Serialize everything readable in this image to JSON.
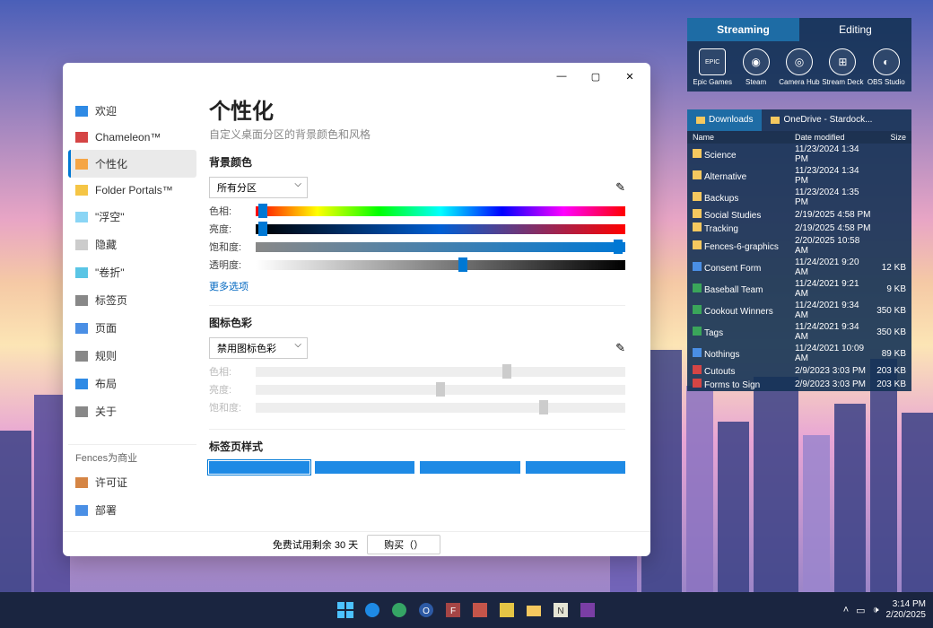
{
  "appWidget": {
    "tabs": [
      "Streaming",
      "Editing"
    ],
    "apps": [
      {
        "label": "Epic Games",
        "icon": "EPIC"
      },
      {
        "label": "Steam",
        "icon": "◉"
      },
      {
        "label": "Camera Hub",
        "icon": "◎"
      },
      {
        "label": "Stream Deck",
        "icon": "⊞"
      },
      {
        "label": "OBS Studio",
        "icon": "◐"
      }
    ]
  },
  "filesWidget": {
    "tabs": [
      "Downloads",
      "OneDrive - Stardock..."
    ],
    "headers": {
      "name": "Name",
      "date": "Date modified",
      "size": "Size"
    },
    "rows": [
      {
        "name": "Science",
        "date": "11/23/2024 1:34 PM",
        "size": "",
        "type": "folder"
      },
      {
        "name": "Alternative",
        "date": "11/23/2024 1:34 PM",
        "size": "",
        "type": "folder"
      },
      {
        "name": "Backups",
        "date": "11/23/2024 1:35 PM",
        "size": "",
        "type": "folder"
      },
      {
        "name": "Social Studies",
        "date": "2/19/2025 4:58 PM",
        "size": "",
        "type": "folder"
      },
      {
        "name": "Tracking",
        "date": "2/19/2025 4:58 PM",
        "size": "",
        "type": "folder"
      },
      {
        "name": "Fences-6-graphics",
        "date": "2/20/2025 10:58 AM",
        "size": "",
        "type": "folder"
      },
      {
        "name": "Consent Form",
        "date": "11/24/2021 9:20 AM",
        "size": "12 KB",
        "type": "doc"
      },
      {
        "name": "Baseball Team",
        "date": "11/24/2021 9:21 AM",
        "size": "9 KB",
        "type": "xls"
      },
      {
        "name": "Cookout Winners",
        "date": "11/24/2021 9:34 AM",
        "size": "350 KB",
        "type": "xls"
      },
      {
        "name": "Tags",
        "date": "11/24/2021 9:34 AM",
        "size": "350 KB",
        "type": "xls"
      },
      {
        "name": "Nothings",
        "date": "11/24/2021 10:09 AM",
        "size": "89 KB",
        "type": "doc"
      },
      {
        "name": "Cutouts",
        "date": "2/9/2023 3:03 PM",
        "size": "203 KB",
        "type": "pdf"
      },
      {
        "name": "Forms to Sign",
        "date": "2/9/2023 3:03 PM",
        "size": "203 KB",
        "type": "pdf"
      }
    ]
  },
  "settings": {
    "sidebar": {
      "items": [
        {
          "label": "欢迎",
          "color": "#2e8ae5"
        },
        {
          "label": "Chameleon™",
          "color": "#d54545"
        },
        {
          "label": "个性化",
          "color": "#f5a545",
          "selected": true
        },
        {
          "label": "Folder Portals™",
          "color": "#f5c545"
        },
        {
          "label": "\"浮空\"",
          "color": "#8ad5f5"
        },
        {
          "label": "隐藏",
          "color": "#cccccc"
        },
        {
          "label": "\"卷折\"",
          "color": "#5ac5e5"
        },
        {
          "label": "标签页",
          "color": "#888888"
        },
        {
          "label": "页面",
          "color": "#4a8fe5"
        },
        {
          "label": "规则",
          "color": "#888888"
        },
        {
          "label": "布局",
          "color": "#2e8ae5"
        },
        {
          "label": "关于",
          "color": "#888888"
        }
      ],
      "section": "Fences为商业",
      "business": [
        {
          "label": "许可证",
          "color": "#d58545"
        },
        {
          "label": "部署",
          "color": "#4a8fe5"
        }
      ]
    },
    "page": {
      "title": "个性化",
      "subtitle": "自定义桌面分区的背景颜色和风格",
      "bg": {
        "heading": "背景颜色",
        "dropdown": "所有分区",
        "sliders": {
          "hue": "色相:",
          "bright": "亮度:",
          "sat": "饱和度:",
          "opacity": "透明度:"
        },
        "more": "更多选项"
      },
      "icon": {
        "heading": "图标色彩",
        "dropdown": "禁用图标色彩",
        "sliders": {
          "hue": "色相:",
          "bright": "亮度:",
          "sat": "饱和度:"
        }
      },
      "style": {
        "heading": "标签页样式"
      }
    },
    "trial": {
      "text": "免费试用剩余 30 天",
      "buy": "购买（）"
    }
  },
  "taskbar": {
    "time": "3:14 PM",
    "date": "2/20/2025"
  }
}
